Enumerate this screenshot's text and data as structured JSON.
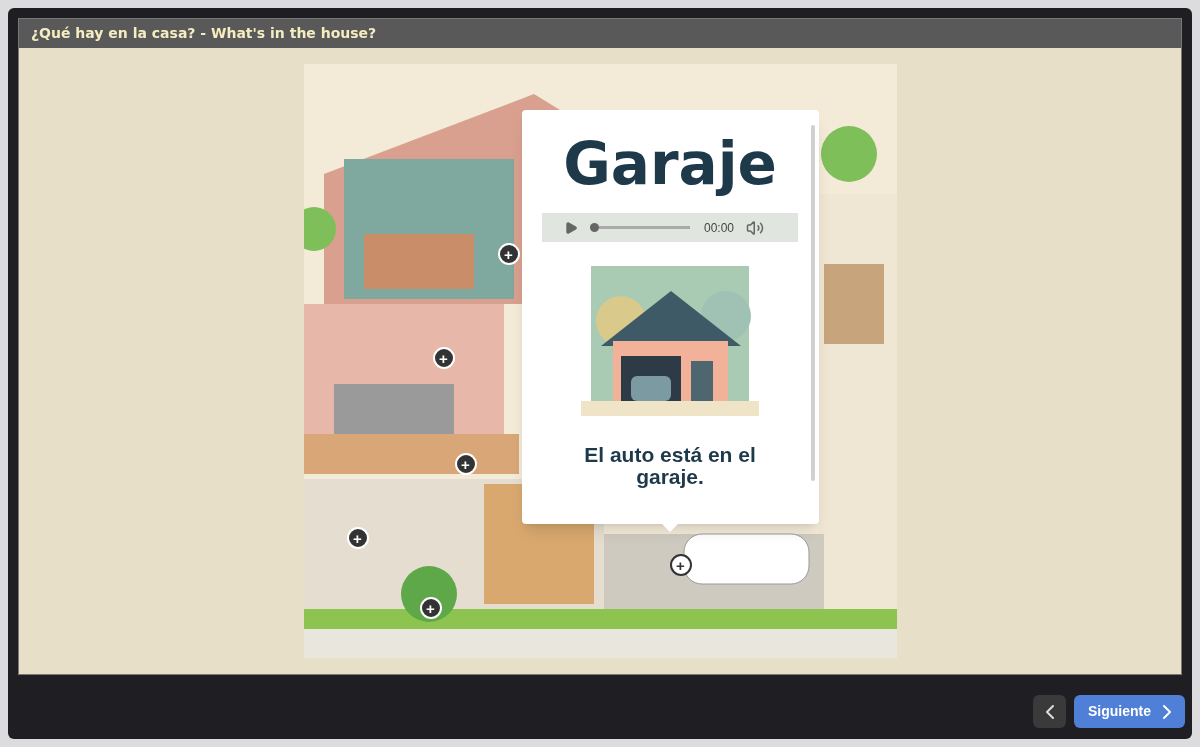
{
  "window": {
    "title": "¿Qué hay en la casa? - What's in the house?"
  },
  "hotspots": [
    {
      "label": "+",
      "selected": false
    },
    {
      "label": "+",
      "selected": false
    },
    {
      "label": "+",
      "selected": false
    },
    {
      "label": "+",
      "selected": false
    },
    {
      "label": "+",
      "selected": false
    },
    {
      "label": "+",
      "selected": true
    }
  ],
  "popup": {
    "title": "Garaje",
    "audio": {
      "time": "00:00",
      "level": 0
    },
    "caption": "El auto está en el garaje."
  },
  "footer": {
    "next_button": "Siguiente"
  }
}
